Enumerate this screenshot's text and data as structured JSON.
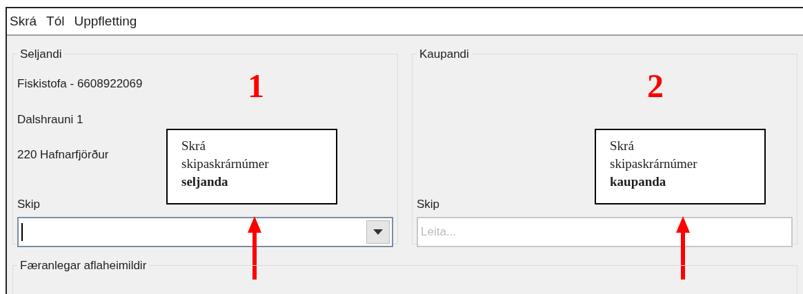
{
  "menu": [
    "Skrá",
    "Tól",
    "Uppfletting"
  ],
  "panels": [
    {
      "title": "Seljandi",
      "number": "1",
      "lines": [
        "Fiskistofa - 6608922069",
        "Dalshrauni 1",
        "220 Hafnarfjörður"
      ],
      "ship_label": "Skip",
      "field": {
        "kind": "combo",
        "focused": true
      },
      "callout": "Skrá skipaskrárnúmer **seljanda**"
    },
    {
      "title": "Kaupandi",
      "number": "2",
      "ship_label": "Skip",
      "field": {
        "kind": "search",
        "focused": false,
        "placeholder": "Leita..."
      },
      "callout": "Skrá skipaskrárnúmer **kaupanda**"
    }
  ],
  "bottom_group": {
    "title": "Færanlegar aflaheimildir"
  }
}
